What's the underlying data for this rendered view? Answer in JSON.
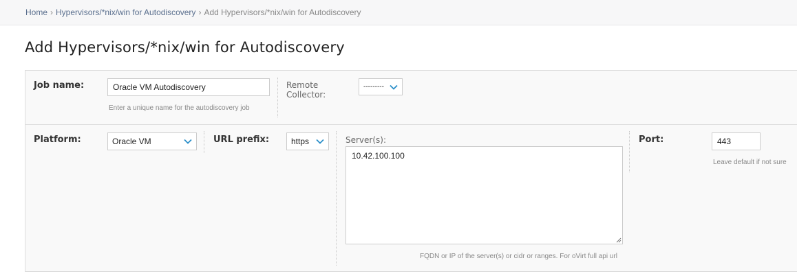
{
  "breadcrumb": {
    "home": "Home",
    "parent": "Hypervisors/*nix/win for Autodiscovery",
    "current": "Add Hypervisors/*nix/win for Autodiscovery",
    "separator": "›"
  },
  "page": {
    "title": "Add Hypervisors/*nix/win for Autodiscovery"
  },
  "form": {
    "job_name": {
      "label": "Job name:",
      "value": "Oracle VM Autodiscovery",
      "help": "Enter a unique name for the autodiscovery job"
    },
    "remote_collector": {
      "label_line1": "Remote",
      "label_line2": "Collector:",
      "value": "---------"
    },
    "platform": {
      "label": "Platform:",
      "value": "Oracle VM"
    },
    "url_prefix": {
      "label": "URL prefix:",
      "value": "https"
    },
    "servers": {
      "label": "Server(s):",
      "value": "10.42.100.100",
      "help": "FQDN or IP of the server(s) or cidr or ranges. For oVirt full api url"
    },
    "port": {
      "label": "Port:",
      "value": "443",
      "help": "Leave default if not sure"
    }
  },
  "icons": {
    "dropdown": "chevron-down-icon",
    "resize": "resize-grip-icon"
  },
  "colors": {
    "chevron": "#2a8fc9",
    "link": "#5a6f8e"
  }
}
